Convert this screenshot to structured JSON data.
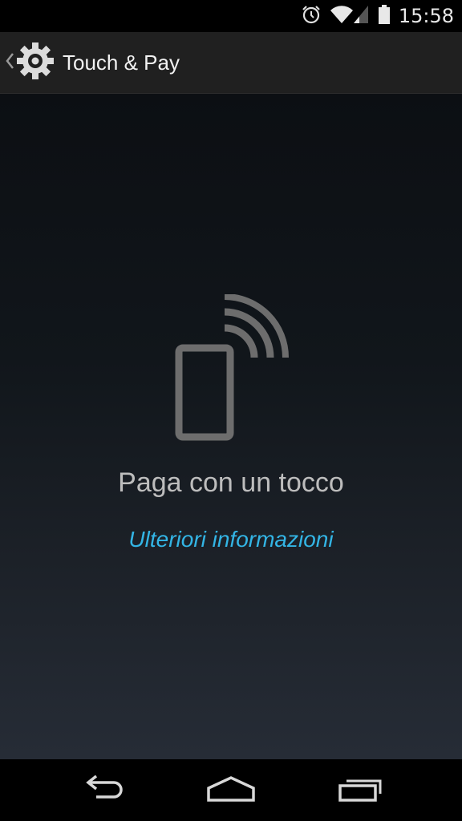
{
  "status_bar": {
    "time": "15:58",
    "icons": [
      "alarm-icon",
      "wifi-icon",
      "signal-icon",
      "battery-icon"
    ]
  },
  "action_bar": {
    "title": "Touch & Pay",
    "icon": "gear-icon",
    "up_icon": "chevron-left-icon"
  },
  "main": {
    "illustration": "phone-nfc-icon",
    "headline": "Paga con un tocco",
    "learn_more": "Ulteriori informazioni"
  },
  "nav_bar": {
    "buttons": [
      "back-icon",
      "home-icon",
      "recent-apps-icon"
    ]
  },
  "colors": {
    "accent": "#33b5e5",
    "action_bar_bg": "#202020",
    "icon_gray": "#6d6d6d"
  }
}
